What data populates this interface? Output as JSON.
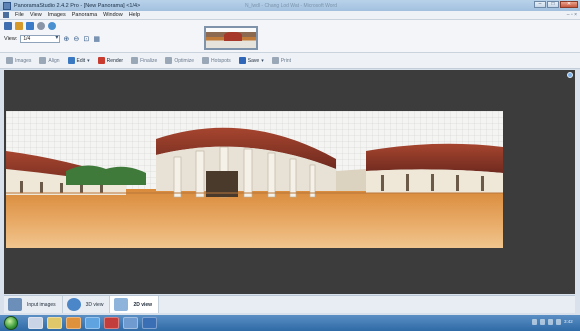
{
  "window": {
    "title": "PanoramaStudio 2.4.2 Pro - [New Panorama] <1/4>",
    "ghost_title": "N_lwdl - Chang Lod Wat - Microsoft Word",
    "controls": [
      "–",
      "□",
      "✕"
    ]
  },
  "menu": {
    "items": [
      "File",
      "View",
      "Images",
      "Panorama",
      "Window",
      "Help"
    ],
    "right_controls": "– ▫ ×"
  },
  "toolbar": {
    "view_label": "View:",
    "view_value": "1/4",
    "icons": [
      "new-icon",
      "open-icon",
      "save-icon",
      "settings-icon",
      "globe-icon"
    ],
    "colors": [
      "#3f6fb0",
      "#d69a2a",
      "#3c7bc8",
      "#8a96a8",
      "#4a8fd0"
    ]
  },
  "actions": [
    {
      "label": "Images",
      "enabled": false,
      "color": "#9aa7b6"
    },
    {
      "label": "Align",
      "enabled": false,
      "color": "#9aa7b6"
    },
    {
      "label": "Edit",
      "enabled": true,
      "color": "#3b78c2",
      "has_menu": true
    },
    {
      "label": "Render",
      "enabled": true,
      "color": "#c83b2e"
    },
    {
      "label": "Finalize",
      "enabled": false,
      "color": "#9aa7b6"
    },
    {
      "label": "Optimize",
      "enabled": false,
      "color": "#9aa7b6"
    },
    {
      "label": "Hotspots",
      "enabled": false,
      "color": "#9aa7b6"
    },
    {
      "label": "Save",
      "enabled": true,
      "color": "#2f66b8",
      "has_menu": true
    },
    {
      "label": "Print",
      "enabled": false,
      "color": "#9aa7b6"
    }
  ],
  "tabs": [
    {
      "label": "Input images",
      "active": false,
      "color": "#6b8fb8"
    },
    {
      "label": "3D view",
      "active": false,
      "color": "#4a86c8"
    },
    {
      "label": "2D view",
      "active": true,
      "color": "#8fb4dc"
    }
  ],
  "taskbar": {
    "app_colors": [
      "#c9d4e6",
      "#e0c86a",
      "#e0913b",
      "#5fa4e0",
      "#c43d3d",
      "#6f9bd0",
      "#3a6fb5"
    ],
    "clock": "3:42"
  }
}
